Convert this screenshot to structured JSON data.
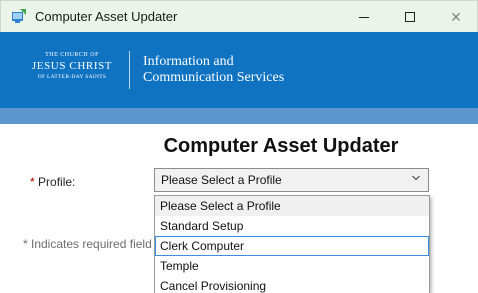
{
  "window": {
    "title": "Computer Asset Updater",
    "minimize": "",
    "maximize": "",
    "close": "✕"
  },
  "banner": {
    "logo_top": "THE CHURCH OF",
    "logo_mid": "JESUS CHRIST",
    "logo_bot": "OF LATTER-DAY SAINTS",
    "org_line1": "Information and",
    "org_line2": "Communication Services",
    "color": "#0f73c2"
  },
  "main": {
    "title": "Computer Asset Updater",
    "profile_star": "*",
    "profile_label": "Profile:",
    "profile_value": "Please Select a Profile",
    "required_note": "* Indicates required field"
  },
  "dropdown": {
    "options": [
      "Please Select a Profile",
      "Standard Setup",
      "Clerk Computer",
      "Temple",
      "Cancel Provisioning"
    ]
  }
}
